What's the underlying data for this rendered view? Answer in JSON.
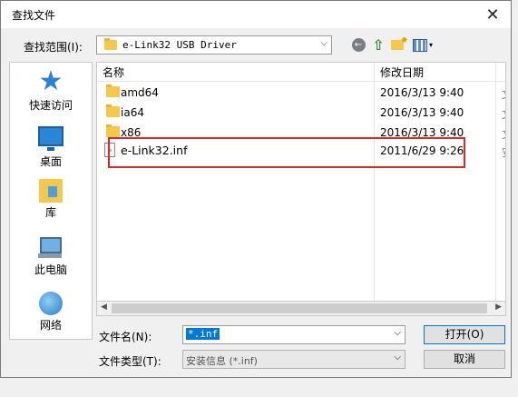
{
  "dialog": {
    "title": "查找文件",
    "close_glyph": "✕"
  },
  "lookin": {
    "label": "查找范围(I):",
    "value": "e-Link32 USB Driver",
    "arrow": "⌵"
  },
  "toolbar": {
    "back_glyph": "←",
    "up_glyph": "⇧",
    "view_dd": "▾"
  },
  "places": [
    {
      "label": "快速访问",
      "icon": "star-icon"
    },
    {
      "label": "桌面",
      "icon": "desktop-icon"
    },
    {
      "label": "库",
      "icon": "library-icon"
    },
    {
      "label": "此电脑",
      "icon": "computer-icon"
    },
    {
      "label": "网络",
      "icon": "network-icon"
    }
  ],
  "list": {
    "col_name": "名称",
    "col_date": "修改日期",
    "col_more": "",
    "rows": [
      {
        "name": "amd64",
        "date": "2016/3/13 9:40",
        "type": "folder"
      },
      {
        "name": "ia64",
        "date": "2016/3/13 9:40",
        "type": "folder"
      },
      {
        "name": "x86",
        "date": "2016/3/13 9:40",
        "type": "folder"
      },
      {
        "name": "e-Link32.inf",
        "date": "2011/6/29 9:26",
        "type": "file"
      }
    ]
  },
  "filename": {
    "label": "文件名(N):",
    "value": "*.inf"
  },
  "filetype": {
    "label": "文件类型(T):",
    "value": "安装信息 (*.inf)"
  },
  "buttons": {
    "open": "打开(O)",
    "cancel": "取消"
  },
  "scroll": {
    "left": "◀",
    "right": "▶"
  },
  "colors": {
    "highlight": "#e0262a",
    "selection": "#0078d7"
  }
}
